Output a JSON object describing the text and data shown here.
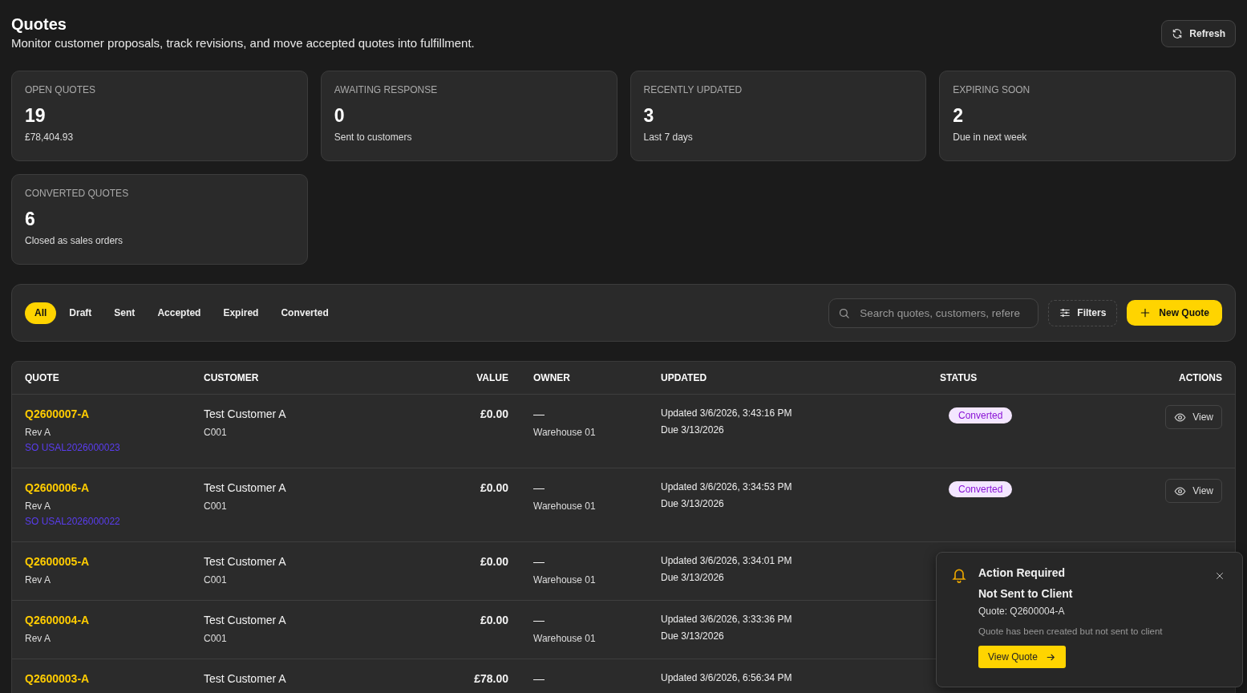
{
  "header": {
    "title": "Quotes",
    "subtitle": "Monitor customer proposals, track revisions, and move accepted quotes into fulfillment.",
    "refresh_button": "Refresh"
  },
  "stats": [
    {
      "label": "OPEN QUOTES",
      "value": "19",
      "note": "£78,404.93"
    },
    {
      "label": "AWAITING RESPONSE",
      "value": "0",
      "note": "Sent to customers"
    },
    {
      "label": "RECENTLY UPDATED",
      "value": "3",
      "note": "Last 7 days"
    },
    {
      "label": "EXPIRING SOON",
      "value": "2",
      "note": "Due in next week"
    },
    {
      "label": "CONVERTED QUOTES",
      "value": "6",
      "note": "Closed as sales orders"
    }
  ],
  "filter_tabs": [
    {
      "label": "All",
      "selected": true
    },
    {
      "label": "Draft",
      "selected": false
    },
    {
      "label": "Sent",
      "selected": false
    },
    {
      "label": "Accepted",
      "selected": false
    },
    {
      "label": "Expired",
      "selected": false
    },
    {
      "label": "Converted",
      "selected": false
    }
  ],
  "search": {
    "placeholder": "Search quotes, customers, refere"
  },
  "filters_button": "Filters",
  "new_quote_button": "New Quote",
  "table": {
    "columns": [
      "QUOTE",
      "CUSTOMER",
      "VALUE",
      "OWNER",
      "UPDATED",
      "STATUS",
      "ACTIONS"
    ],
    "rows": [
      {
        "quote": "Q2600007-A",
        "revision": "Rev A",
        "sales_order": "SO USAL2026000023",
        "customer": "Test Customer A",
        "customer_code": "C001",
        "value": "£0.00",
        "owner": "—",
        "location": "Warehouse 01",
        "updated": "Updated 3/6/2026, 3:43:16 PM",
        "due": "Due 3/13/2026",
        "status": {
          "label": "Converted",
          "kind": "converted"
        },
        "action": "View"
      },
      {
        "quote": "Q2600006-A",
        "revision": "Rev A",
        "sales_order": "SO USAL2026000022",
        "customer": "Test Customer A",
        "customer_code": "C001",
        "value": "£0.00",
        "owner": "—",
        "location": "Warehouse 01",
        "updated": "Updated 3/6/2026, 3:34:53 PM",
        "due": "Due 3/13/2026",
        "status": {
          "label": "Converted",
          "kind": "converted"
        },
        "action": "View"
      },
      {
        "quote": "Q2600005-A",
        "revision": "Rev A",
        "customer": "Test Customer A",
        "customer_code": "C001",
        "value": "£0.00",
        "owner": "—",
        "location": "Warehouse 01",
        "updated": "Updated 3/6/2026, 3:34:01 PM",
        "due": "Due 3/13/2026"
      },
      {
        "quote": "Q2600004-A",
        "revision": "Rev A",
        "customer": "Test Customer A",
        "customer_code": "C001",
        "value": "£0.00",
        "owner": "—",
        "location": "Warehouse 01",
        "updated": "Updated 3/6/2026, 3:33:36 PM",
        "due": "Due 3/13/2026"
      },
      {
        "quote": "Q2600003-A",
        "customer": "Test Customer A",
        "value": "£78.00",
        "owner": "—",
        "updated": "Updated 3/6/2026, 6:56:34 PM"
      }
    ]
  },
  "toast": {
    "title": "Action Required",
    "heading": "Not Sent to Client",
    "quote": "Quote: Q2600004-A",
    "message": "Quote has been created but not sent to client",
    "button": "View Quote"
  }
}
